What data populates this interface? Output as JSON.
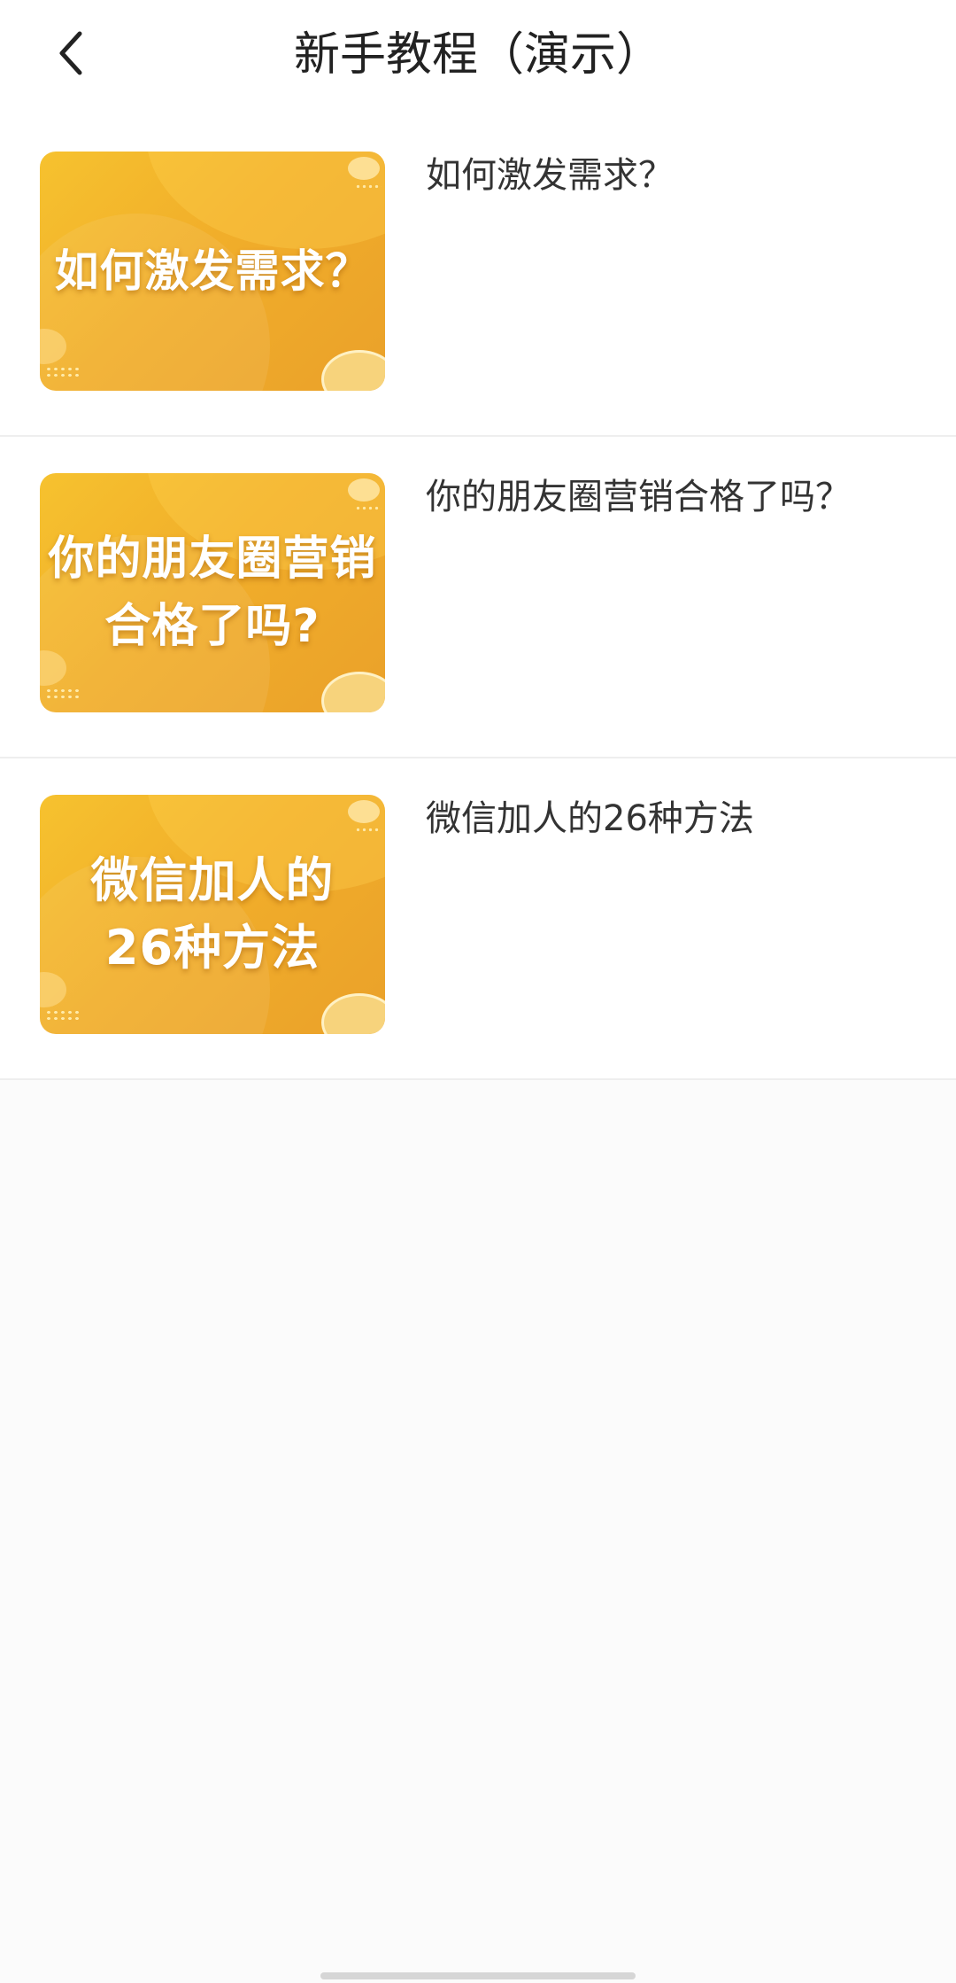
{
  "header": {
    "back_icon": "chevron-left-icon",
    "title": "新手教程（演示）"
  },
  "tutorials": [
    {
      "thumbnail_text": "如何激发需求？",
      "title": "如何激发需求？"
    },
    {
      "thumbnail_text": "你的朋友圈营销\n合格了吗?",
      "title": "你的朋友圈营销合格了吗？"
    },
    {
      "thumbnail_text": "微信加人的\n26种方法",
      "title": "微信加人的26种方法"
    }
  ],
  "colors": {
    "thumbnail_gradient_start": "#f6c22f",
    "thumbnail_gradient_end": "#eaa12a",
    "divider": "#eeeeee",
    "text": "#333333"
  }
}
